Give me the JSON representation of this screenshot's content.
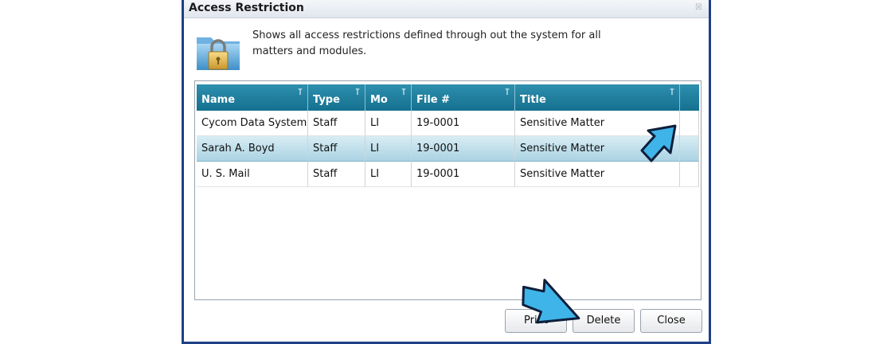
{
  "dialog": {
    "title": "Access Restriction",
    "close_glyph": "☒",
    "description": "Shows all access restrictions defined through out the system for all matters and modules."
  },
  "grid": {
    "columns": [
      {
        "label": "Name",
        "filter": "⊺"
      },
      {
        "label": "Type",
        "filter": "⊺"
      },
      {
        "label": "Mo",
        "filter": "⊺"
      },
      {
        "label": "File #",
        "filter": "⊺"
      },
      {
        "label": "Title",
        "filter": "⊺"
      }
    ],
    "rows": [
      {
        "name": "Cycom Data System",
        "type": "Staff",
        "module": "LI",
        "file": "19-0001",
        "title": "Sensitive Matter"
      },
      {
        "name": "Sarah A. Boyd",
        "type": "Staff",
        "module": "LI",
        "file": "19-0001",
        "title": "Sensitive Matter"
      },
      {
        "name": "U. S. Mail",
        "type": "Staff",
        "module": "LI",
        "file": "19-0001",
        "title": "Sensitive Matter"
      }
    ],
    "selected_row": 1
  },
  "buttons": {
    "print": "Print",
    "delete": "Delete",
    "close": "Close"
  },
  "colors": {
    "header": "#1f7fa0",
    "selection": "#b6dbe8",
    "arrow": "#3fb4e8",
    "frame": "#1f3f86"
  },
  "icons": [
    "folder-lock-icon",
    "filter-icon",
    "close-icon",
    "pointer-arrow"
  ]
}
